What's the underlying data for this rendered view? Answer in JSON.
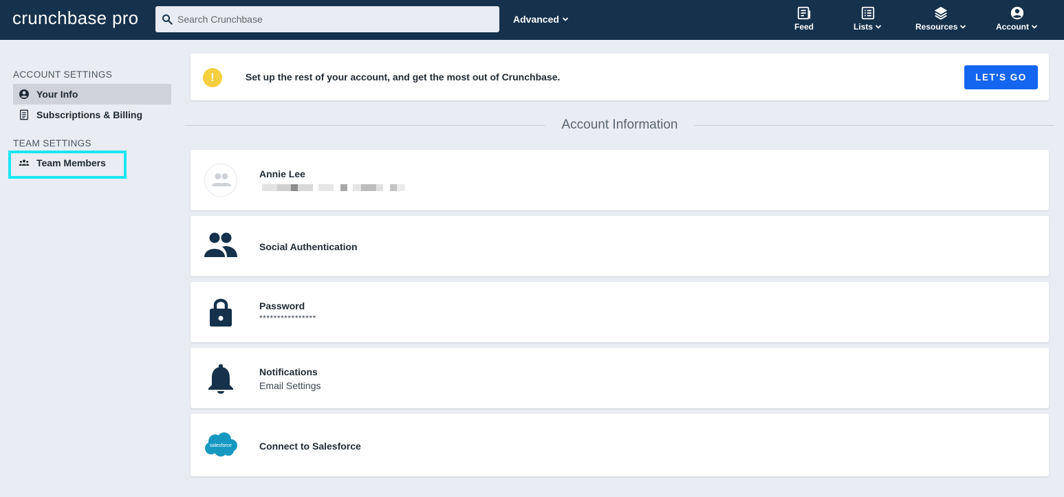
{
  "header": {
    "logo": "crunchbase pro",
    "search_placeholder": "Search Crunchbase",
    "advanced_label": "Advanced",
    "nav": [
      {
        "label": "Feed",
        "icon": "feed-icon"
      },
      {
        "label": "Lists",
        "icon": "lists-icon"
      },
      {
        "label": "Resources",
        "icon": "layers-icon"
      },
      {
        "label": "Account",
        "icon": "account-circle-icon"
      }
    ]
  },
  "sidebar": {
    "account_heading": "ACCOUNT SETTINGS",
    "account_items": [
      {
        "label": "Your Info",
        "icon": "account-circle-icon",
        "active": true
      },
      {
        "label": "Subscriptions & Billing",
        "icon": "receipt-icon",
        "active": false
      }
    ],
    "team_heading": "TEAM SETTINGS",
    "team_items": [
      {
        "label": "Team Members",
        "icon": "people-icon"
      }
    ]
  },
  "banner": {
    "text": "Set up the rest of your account, and get the most out of Crunchbase.",
    "button_label": "LET'S GO",
    "icon": "warning-icon"
  },
  "section_title": "Account Information",
  "cards": [
    {
      "title": "Annie Lee",
      "subtitle": "",
      "icon": "avatar-placeholder-icon"
    },
    {
      "title": "Social Authentication",
      "subtitle": "",
      "icon": "people-icon"
    },
    {
      "title": "Password",
      "subtitle": "****************",
      "icon": "lock-icon"
    },
    {
      "title": "Notifications",
      "subtitle": "Email Settings",
      "icon": "bell-icon"
    },
    {
      "title": "Connect to Salesforce",
      "subtitle": "",
      "icon": "salesforce-logo"
    }
  ],
  "colors": {
    "header_bg": "#15314b",
    "page_bg": "#e9ecf3",
    "accent_button": "#1466f0",
    "warning": "#f5cf3f",
    "highlight": "#19e6f0",
    "icon_dark": "#15314b",
    "salesforce": "#1798c1"
  }
}
